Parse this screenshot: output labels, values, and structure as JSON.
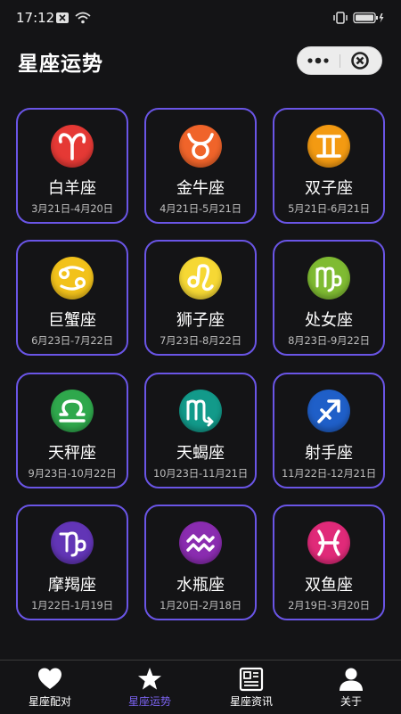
{
  "status_bar": {
    "time": "17:12"
  },
  "header": {
    "title": "星座运势"
  },
  "capsule": {
    "more_icon": "more-icon",
    "close_icon": "close-circle-icon"
  },
  "signs": [
    {
      "name": "白羊座",
      "dates": "3月21日-4月20日",
      "icon": "aries-icon",
      "color": "#e53935"
    },
    {
      "name": "金牛座",
      "dates": "4月21日-5月21日",
      "icon": "taurus-icon",
      "color": "#f0642a"
    },
    {
      "name": "双子座",
      "dates": "5月21日-6月21日",
      "icon": "gemini-icon",
      "color": "#f39a12"
    },
    {
      "name": "巨蟹座",
      "dates": "6月23日-7月22日",
      "icon": "cancer-icon",
      "color": "#f2c21b"
    },
    {
      "name": "狮子座",
      "dates": "7月23日-8月22日",
      "icon": "leo-icon",
      "color": "#f6d834"
    },
    {
      "name": "处女座",
      "dates": "8月23日-9月22日",
      "icon": "virgo-icon",
      "color": "#7fbb32"
    },
    {
      "name": "天秤座",
      "dates": "9月23日-10月22日",
      "icon": "libra-icon",
      "color": "#2fa84c"
    },
    {
      "name": "天蝎座",
      "dates": "10月23日-11月21日",
      "icon": "scorpio-icon",
      "color": "#129a8a"
    },
    {
      "name": "射手座",
      "dates": "11月22日-12月21日",
      "icon": "sagittarius-icon",
      "color": "#1f5fc8"
    },
    {
      "name": "摩羯座",
      "dates": "1月22日-1月19日",
      "icon": "capricorn-icon",
      "color": "#6235b6"
    },
    {
      "name": "水瓶座",
      "dates": "1月20日-2月18日",
      "icon": "aquarius-icon",
      "color": "#8a2cb0"
    },
    {
      "name": "双鱼座",
      "dates": "2月19日-3月20日",
      "icon": "pisces-icon",
      "color": "#e02a79"
    }
  ],
  "tabs": [
    {
      "label": "星座配对",
      "icon": "heart-icon",
      "active": false
    },
    {
      "label": "星座运势",
      "icon": "star-icon",
      "active": true
    },
    {
      "label": "星座资讯",
      "icon": "news-icon",
      "active": false
    },
    {
      "label": "关于",
      "icon": "user-icon",
      "active": false
    }
  ],
  "accent_color": "#7b63f0",
  "card_border_color": "#6a55e6"
}
